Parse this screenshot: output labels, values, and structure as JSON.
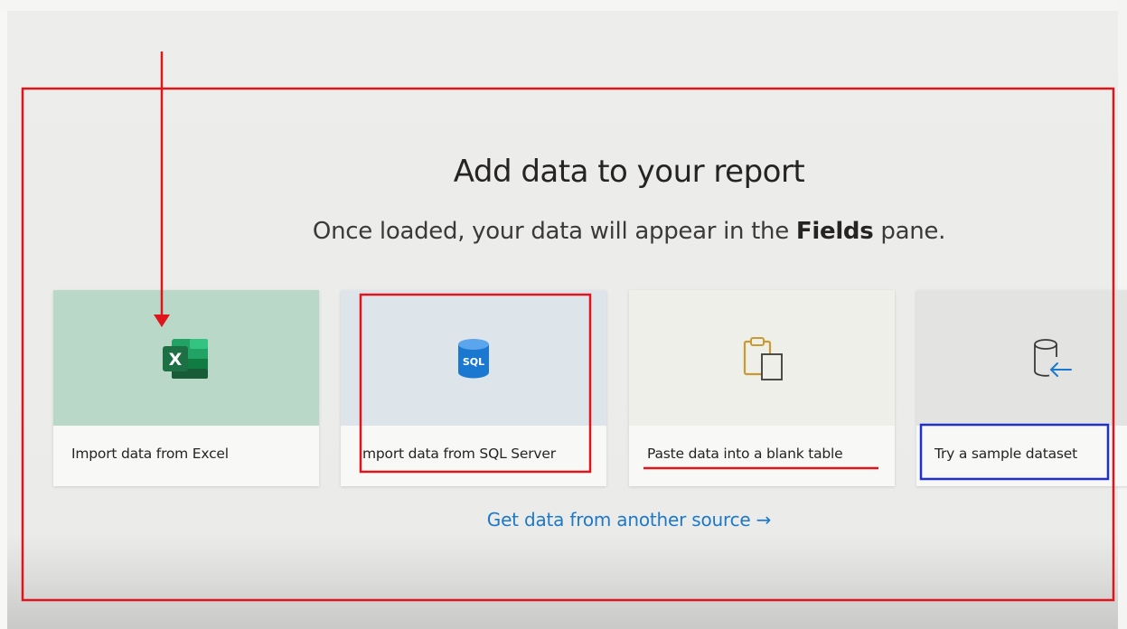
{
  "dialog": {
    "title": "Add data to your report",
    "subtitle_before": "Once loaded, your data will appear in the ",
    "subtitle_bold": "Fields",
    "subtitle_after": " pane."
  },
  "cards": [
    {
      "label": "Import data from Excel",
      "icon": "excel-icon",
      "thumb_color": "#bad8c7"
    },
    {
      "label": "mport data from SQL Server",
      "icon": "sql-database-icon",
      "thumb_color": "#dde5eb"
    },
    {
      "label": "Paste data into a blank table",
      "icon": "clipboard-paste-icon",
      "thumb_color": "#efefea"
    },
    {
      "label": "Try a sample dataset",
      "icon": "sample-dataset-icon",
      "thumb_color": "#e3e3e2"
    }
  ],
  "icons": {
    "sql_text": "SQL",
    "excel_letter": "X"
  },
  "footer": {
    "link_text": "Get data from another source →"
  },
  "colors": {
    "accent_link": "#1d79c7",
    "annotation_red": "#e0141b",
    "annotation_blue": "#1f2fd0",
    "excel_green": "#1d7044",
    "sql_blue": "#1b78d0"
  }
}
